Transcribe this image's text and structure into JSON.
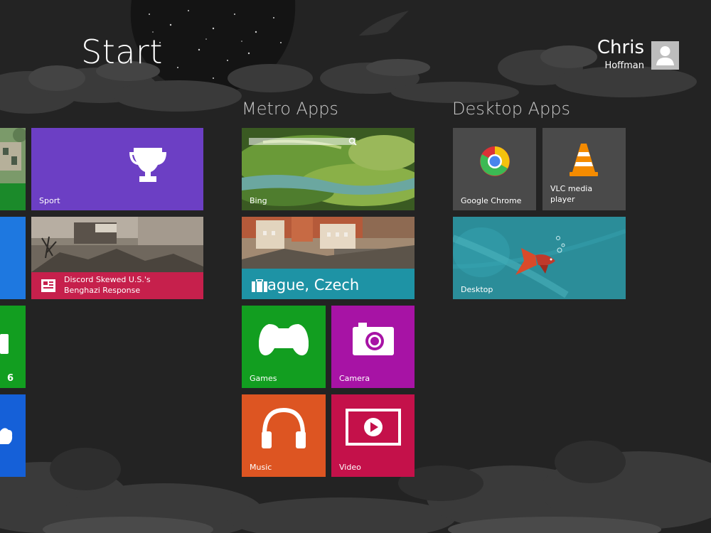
{
  "screen": {
    "title": "Start",
    "user": {
      "first_name": "Chris",
      "last_name": "Hoffman"
    }
  },
  "groups": [
    {
      "label": "Metro Apps"
    },
    {
      "label": "Desktop Apps"
    }
  ],
  "tiles": {
    "sport": {
      "label": "Sport",
      "color": "#6c3fc4",
      "icon": "trophy-icon"
    },
    "news": {
      "label": "Discord Skewed U.S.'s Benghazi Response",
      "color": "#c6204c",
      "icon": "news-icon"
    },
    "bing": {
      "label": "Bing",
      "icon": "search-icon"
    },
    "travel": {
      "label": "ague, Czech",
      "color": "#1e93a5",
      "icon": "suitcase-icon"
    },
    "games": {
      "label": "Games",
      "color": "#129e20",
      "icon": "xbox-controller-icon"
    },
    "camera": {
      "label": "Camera",
      "color": "#a713a5",
      "icon": "camera-icon"
    },
    "music": {
      "label": "Music",
      "color": "#dd5522",
      "icon": "headphones-icon"
    },
    "video": {
      "label": "Video",
      "color": "#c4114a",
      "icon": "play-icon"
    },
    "chrome": {
      "label": "Google Chrome",
      "color": "#4a4a4a",
      "icon": "chrome-icon"
    },
    "vlc": {
      "label": "VLC media player",
      "label_line1": "VLC media",
      "label_line2": "player",
      "color": "#4a4a4a",
      "icon": "vlc-cone-icon"
    },
    "desktop": {
      "label": "Desktop",
      "color": "#2a8a96",
      "icon": "fish-icon"
    },
    "partial_count": "6",
    "partial_colors": [
      "#1b8a2a",
      "#1e78e0",
      "#129e20",
      "#1560d8"
    ]
  }
}
